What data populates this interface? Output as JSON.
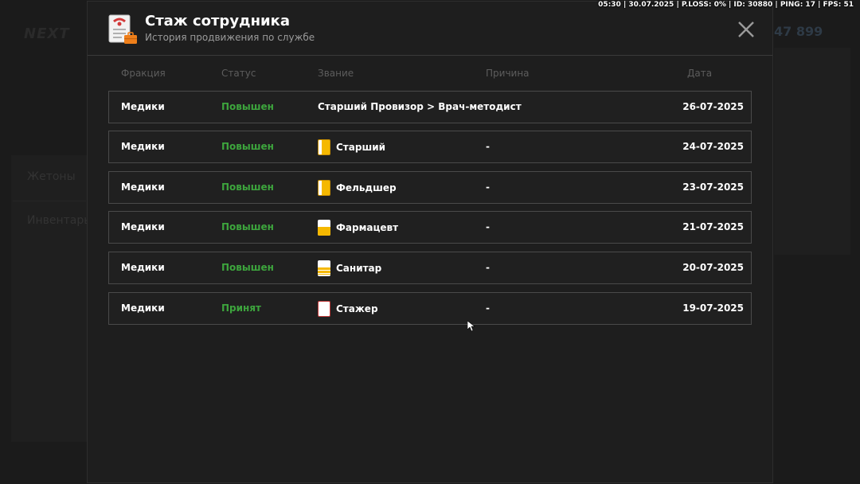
{
  "status_bar": "05:30 | 30.07.2025 | P.LOSS: 0% | ID: 30880 | PING: 17 | FPS: 51",
  "background": {
    "logo": "NEXT",
    "money": "47 899",
    "left_items": [
      "Жетоны",
      "Инвентарь"
    ]
  },
  "modal": {
    "title": "Стаж сотрудника",
    "subtitle": "История продвижения по службе",
    "icons": {
      "header": "document-briefcase-icon",
      "close": "close-icon"
    },
    "columns": [
      "Фракция",
      "Статус",
      "Звание",
      "Причина",
      "Дата"
    ],
    "rows": [
      {
        "faction": "Медики",
        "status": "Повышен",
        "rank": "Старший Провизор > Врач-методист",
        "badge": "none",
        "reason": "",
        "date": "26-07-2025"
      },
      {
        "faction": "Медики",
        "status": "Повышен",
        "rank": "Старший",
        "badge": "gold",
        "reason": "-",
        "date": "24-07-2025"
      },
      {
        "faction": "Медики",
        "status": "Повышен",
        "rank": "Фельдшер",
        "badge": "gold",
        "reason": "-",
        "date": "23-07-2025"
      },
      {
        "faction": "Медики",
        "status": "Повышен",
        "rank": "Фармацевт",
        "badge": "half",
        "reason": "-",
        "date": "21-07-2025"
      },
      {
        "faction": "Медики",
        "status": "Повышен",
        "rank": "Санитар",
        "badge": "stripe",
        "reason": "-",
        "date": "20-07-2025"
      },
      {
        "faction": "Медики",
        "status": "Принят",
        "rank": "Стажер",
        "badge": "white",
        "reason": "-",
        "date": "19-07-2025"
      }
    ]
  },
  "colors": {
    "status_green": "#3da53d",
    "badge_gold": "#f5b800"
  }
}
